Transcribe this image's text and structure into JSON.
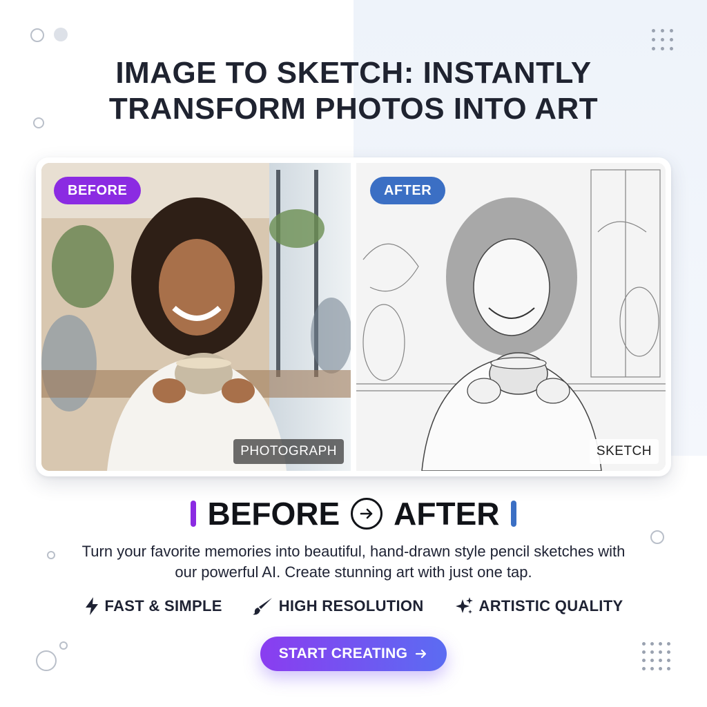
{
  "headline": {
    "line1": "IMAGE TO SKETCH: INSTANTLY",
    "line2": "TRANSFORM PHOTOS INTO ART"
  },
  "comparison": {
    "before_label": "BEFORE",
    "after_label": "AFTER",
    "before_caption": "PHOTOGRAPH",
    "after_caption": "SKETCH"
  },
  "compare_heading": {
    "before": "BEFORE",
    "after": "AFTER"
  },
  "description": "Turn your favorite memories into beautiful, hand-drawn style pencil sketches with our powerful AI. Create stunning art with just one tap.",
  "features": [
    {
      "icon": "lightning-bolt-icon",
      "label": "FAST & SIMPLE"
    },
    {
      "icon": "paintbrush-icon",
      "label": "HIGH RESOLUTION"
    },
    {
      "icon": "sparkles-icon",
      "label": "ARTISTIC QUALITY"
    }
  ],
  "cta": {
    "label": "START CREATING"
  },
  "colors": {
    "purple_accent": "#8b2be2",
    "blue_accent": "#3b6fc4",
    "cta_gradient_start": "#8a3df0",
    "cta_gradient_end": "#5b6cf2"
  }
}
